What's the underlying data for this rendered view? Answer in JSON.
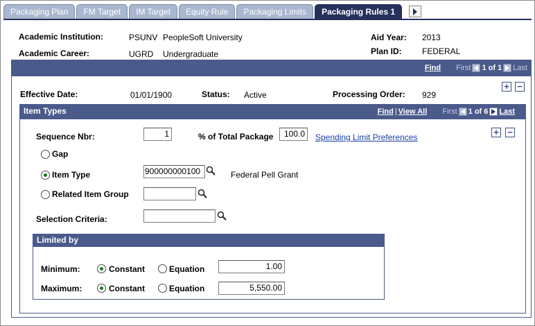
{
  "tabs": [
    {
      "label": "Packaging Plan",
      "active": false
    },
    {
      "label": "FM Target",
      "active": false
    },
    {
      "label": "IM Target",
      "active": false
    },
    {
      "label": "Equity Rule",
      "active": false
    },
    {
      "label": "Packaging Limits",
      "active": false
    },
    {
      "label": "Packaging Rules 1",
      "active": true
    }
  ],
  "header": {
    "institution_label": "Academic Institution:",
    "institution_code": "PSUNV",
    "institution_name": "PeopleSoft University",
    "career_label": "Academic Career:",
    "career_code": "UGRD",
    "career_name": "Undergraduate",
    "aid_year_label": "Aid Year:",
    "aid_year": "2013",
    "plan_id_label": "Plan ID:",
    "plan_id": "FEDERAL"
  },
  "outer_nav": {
    "find": "Find",
    "first": "First",
    "count": "1 of 1",
    "last": "Last"
  },
  "effective": {
    "date_label": "Effective Date:",
    "date": "01/01/1900",
    "status_label": "Status:",
    "status": "Active",
    "order_label": "Processing Order:",
    "order": "929"
  },
  "item_types": {
    "title": "Item Types",
    "find": "Find",
    "view_all": "View All",
    "first": "First",
    "count": "1 of 6",
    "last": "Last",
    "seq_label": "Sequence Nbr:",
    "seq_value": "1",
    "pct_label": "% of Total Package",
    "pct_value": "100.0",
    "spending_link": "Spending Limit Preferences",
    "gap_label": "Gap",
    "item_type_label": "Item Type",
    "item_type_value": "900000000100",
    "item_type_desc": "Federal Pell Grant",
    "related_label": "Related Item Group",
    "related_value": "",
    "criteria_label": "Selection Criteria:",
    "criteria_value": ""
  },
  "limited_by": {
    "title": "Limited by",
    "minimum_label": "Minimum:",
    "maximum_label": "Maximum:",
    "constant_label": "Constant",
    "equation_label": "Equation",
    "minimum_value": "1.00",
    "maximum_value": "5,550.00"
  },
  "colors": {
    "header_bar": "#4a5a8a",
    "active_tab": "#25315a",
    "inactive_tab": "#a9b7cf",
    "link": "#1b3fa5"
  }
}
